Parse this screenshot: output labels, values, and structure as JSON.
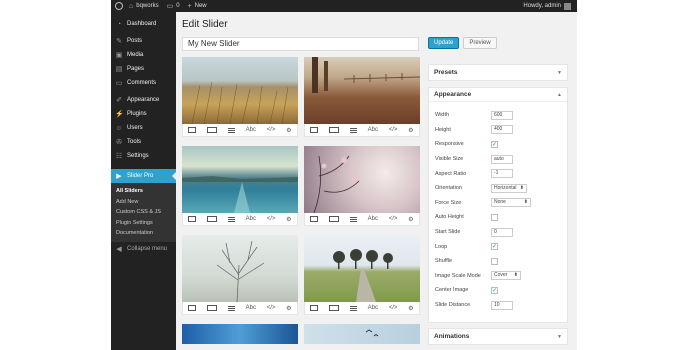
{
  "adminbar": {
    "site_name": "bqworks",
    "comments_count": "0",
    "new_label": "New",
    "howdy": "Howdy, admin"
  },
  "sidebar": {
    "items": [
      {
        "icon": "dashboard-icon",
        "glyph": "◔",
        "label": "Dashboard"
      },
      {
        "icon": "pin-icon",
        "glyph": "✎",
        "label": "Posts"
      },
      {
        "icon": "media-icon",
        "glyph": "▣",
        "label": "Media"
      },
      {
        "icon": "pages-icon",
        "glyph": "▤",
        "label": "Pages"
      },
      {
        "icon": "comments-icon",
        "glyph": "▭",
        "label": "Comments"
      },
      {
        "icon": "appearance-icon",
        "glyph": "✐",
        "label": "Appearance"
      },
      {
        "icon": "plugins-icon",
        "glyph": "⚡",
        "label": "Plugins"
      },
      {
        "icon": "users-icon",
        "glyph": "☺",
        "label": "Users"
      },
      {
        "icon": "tools-icon",
        "glyph": "✇",
        "label": "Tools"
      },
      {
        "icon": "settings-icon",
        "glyph": "☷",
        "label": "Settings"
      }
    ],
    "active": {
      "icon": "slider-pro-icon",
      "glyph": "▶",
      "label": "Slider Pro"
    },
    "submenu": [
      "All Sliders",
      "Add New",
      "Custom CSS & JS",
      "Plugin Settings",
      "Documentation"
    ],
    "collapse": {
      "glyph": "◀",
      "label": "Collapse menu"
    }
  },
  "main": {
    "page_title": "Edit Slider",
    "slider_name": "My New Slider",
    "tool_labels": {
      "text": "Abc",
      "html": "</>",
      "settings": "⚙"
    }
  },
  "panel": {
    "update_label": "Update",
    "preview_label": "Preview",
    "presets_title": "Presets",
    "appearance_title": "Appearance",
    "animations_title": "Animations",
    "fields": {
      "width": {
        "label": "Width",
        "value": "600"
      },
      "height": {
        "label": "Height",
        "value": "400"
      },
      "responsive": {
        "label": "Responsive",
        "checked": "✓"
      },
      "visible_size": {
        "label": "Visible Size",
        "value": "auto"
      },
      "aspect_ratio": {
        "label": "Aspect Ratio",
        "value": "-1"
      },
      "orientation": {
        "label": "Orientation",
        "value": "Horizontal"
      },
      "force_size": {
        "label": "Force Size",
        "value": "None"
      },
      "auto_height": {
        "label": "Auto Height",
        "checked": ""
      },
      "start_slide": {
        "label": "Start Slide",
        "value": "0"
      },
      "loop": {
        "label": "Loop",
        "checked": "✓"
      },
      "shuffle": {
        "label": "Shuffle",
        "checked": ""
      },
      "image_scale_mode": {
        "label": "Image Scale Mode",
        "value": "Cover"
      },
      "center_image": {
        "label": "Center Image",
        "checked": "✓"
      },
      "slide_distance": {
        "label": "Slide Distance",
        "value": "10"
      }
    }
  }
}
